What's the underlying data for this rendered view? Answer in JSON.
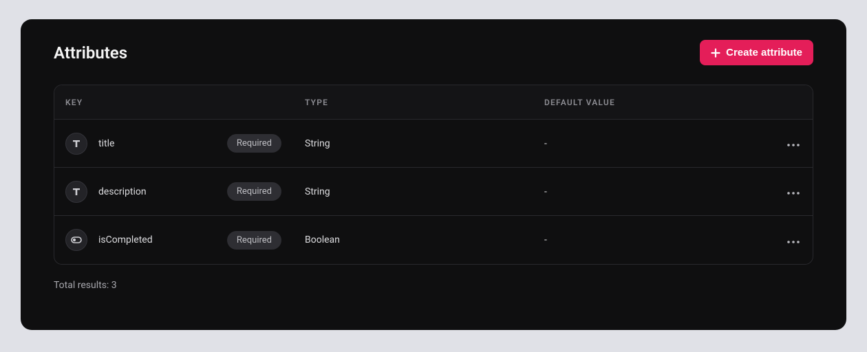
{
  "header": {
    "title": "Attributes",
    "create_label": "Create attribute"
  },
  "table": {
    "columns": {
      "key": "KEY",
      "type": "TYPE",
      "default": "DEFAULT VALUE"
    },
    "rows": [
      {
        "icon": "text-icon",
        "key": "title",
        "badge": "Required",
        "type": "String",
        "default": "-"
      },
      {
        "icon": "text-icon",
        "key": "description",
        "badge": "Required",
        "type": "String",
        "default": "-"
      },
      {
        "icon": "toggle-icon",
        "key": "isCompleted",
        "badge": "Required",
        "type": "Boolean",
        "default": "-"
      }
    ]
  },
  "footer": {
    "total_label": "Total results: 3"
  }
}
